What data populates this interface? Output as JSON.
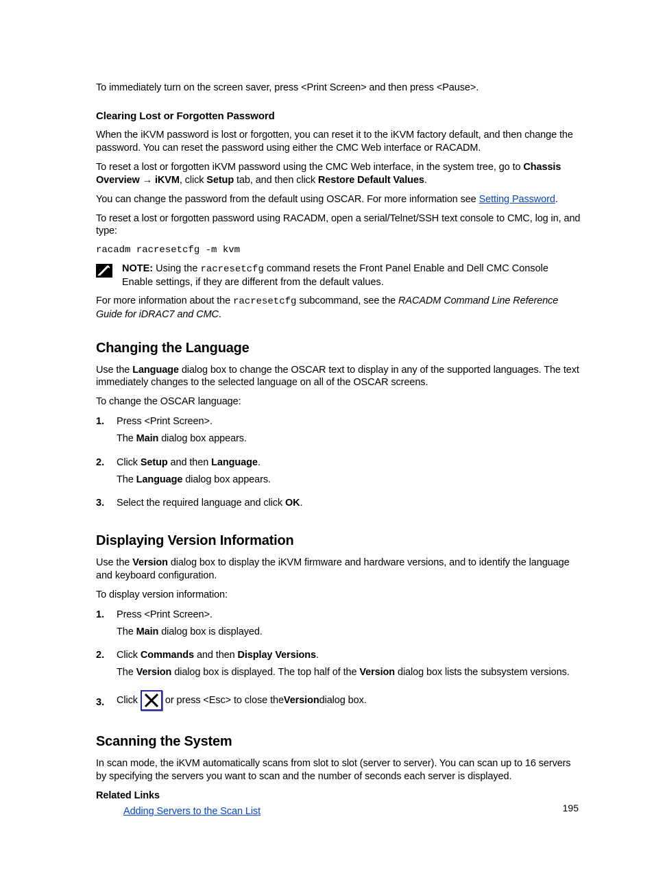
{
  "intro": "To immediately turn on the screen saver, press <Print Screen> and then press <Pause>.",
  "clearing": {
    "heading": "Clearing Lost or Forgotten Password",
    "p1": "When the iKVM password is lost or forgotten, you can reset it to the iKVM factory default, and then change the password. You can reset the password using either the CMC Web interface or RACADM.",
    "p2a": "To reset a lost or forgotten iKVM password using the CMC Web interface, in the system tree, go to ",
    "p2b": "Chassis Overview",
    "p2c": " → ",
    "p2d": "iKVM",
    "p2e": ", click ",
    "p2f": "Setup",
    "p2g": " tab, and then click ",
    "p2h": "Restore Default Values",
    "p2i": ".",
    "p3a": "You can change the password from the default using OSCAR. For more information see ",
    "p3link": "Setting Password",
    "p3b": ".",
    "p4": "To reset a lost or forgotten password using RACADM, open a serial/Telnet/SSH text console to CMC, log in, and type:",
    "cmd": "racadm racresetcfg -m kvm",
    "note_label": "NOTE:",
    "note_a": " Using the ",
    "note_code": "racresetcfg",
    "note_b": " command resets the Front Panel Enable and Dell CMC Console Enable settings, if they are different from the default values.",
    "p5a": "For more information about the ",
    "p5code": "racresetcfg",
    "p5b": " subcommand, see the ",
    "p5italic": "RACADM Command Line Reference Guide for iDRAC7 and CMC",
    "p5c": "."
  },
  "changing": {
    "heading": "Changing the Language",
    "p1a": "Use the ",
    "p1b": "Language",
    "p1c": " dialog box to change the OSCAR text to display in any of the supported languages. The text immediately changes to the selected language on all of the OSCAR screens.",
    "p2": "To change the OSCAR language:",
    "steps": [
      {
        "n": "1.",
        "a": "Press <Print Screen>.",
        "b1": "The ",
        "b2": "Main",
        "b3": " dialog box appears."
      },
      {
        "n": "2.",
        "a1": "Click ",
        "a2": "Setup",
        "a3": " and then ",
        "a4": "Language",
        "a5": ".",
        "b1": "The ",
        "b2": "Language",
        "b3": " dialog box appears."
      },
      {
        "n": "3.",
        "a1": "Select the required language and click ",
        "a2": "OK",
        "a3": "."
      }
    ]
  },
  "version": {
    "heading": "Displaying Version Information",
    "p1a": "Use the ",
    "p1b": "Version",
    "p1c": " dialog box to display the iKVM firmware and hardware versions, and to identify the language and keyboard configuration.",
    "p2": "To display version information:",
    "steps": [
      {
        "n": "1.",
        "a": "Press <Print Screen>.",
        "b1": "The ",
        "b2": "Main",
        "b3": " dialog box is displayed."
      },
      {
        "n": "2.",
        "a1": "Click ",
        "a2": "Commands",
        "a3": " and then ",
        "a4": "Display Versions",
        "a5": ".",
        "b1": "The ",
        "b2": "Version",
        "b3": " dialog box is displayed. The top half of the ",
        "b4": "Version",
        "b5": " dialog box lists the subsystem versions."
      },
      {
        "n": "3.",
        "a1": "Click ",
        "a2": " or press <Esc> to close the ",
        "a3": "Version",
        "a4": " dialog box."
      }
    ]
  },
  "scanning": {
    "heading": "Scanning the System",
    "p1": "In scan mode, the iKVM automatically scans from slot to slot (server to server). You can scan up to 16 servers by specifying the servers you want to scan and the number of seconds each server is displayed.",
    "related": "Related Links",
    "link": "Adding Servers to the Scan List"
  },
  "page_number": "195"
}
